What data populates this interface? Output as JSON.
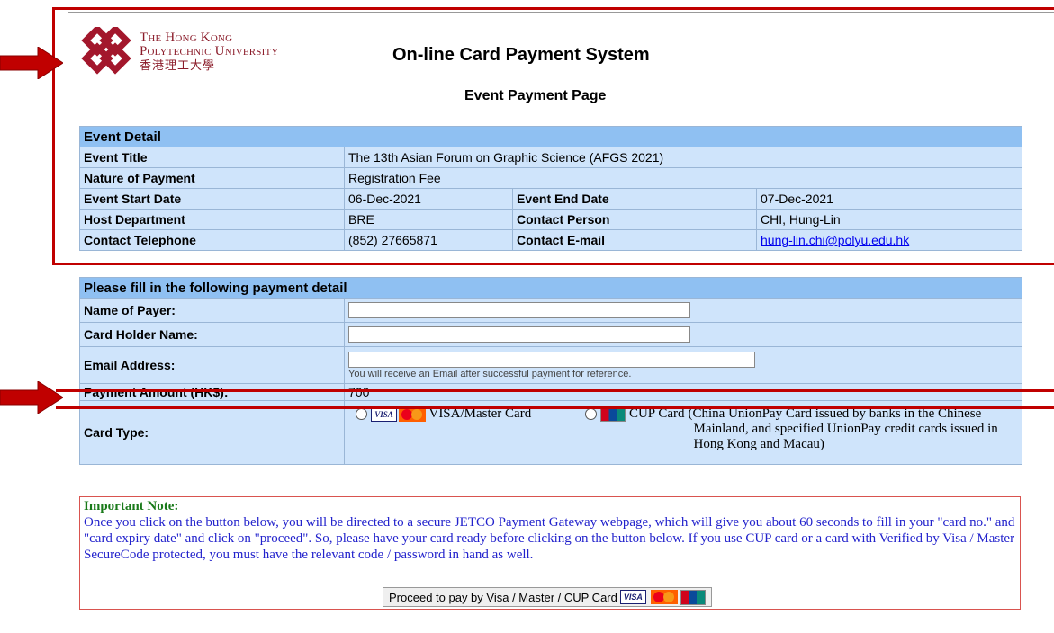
{
  "logo": {
    "line1": "The Hong Kong",
    "line2": "Polytechnic University",
    "line3": "香港理工大學"
  },
  "system_title": "On-line Card Payment System",
  "page_subtitle": "Event Payment Page",
  "event_detail": {
    "header": "Event Detail",
    "title_label": "Event Title",
    "title_value": "The 13th Asian Forum on Graphic Science (AFGS 2021)",
    "nature_label": "Nature of Payment",
    "nature_value": "Registration Fee",
    "start_label": "Event Start Date",
    "start_value": "06-Dec-2021",
    "end_label": "Event End Date",
    "end_value": "07-Dec-2021",
    "host_label": "Host Department",
    "host_value": "BRE",
    "contact_label": "Contact Person",
    "contact_value": "CHI, Hung-Lin",
    "tel_label": "Contact Telephone",
    "tel_value": "(852) 27665871",
    "email_label": "Contact E-mail",
    "email_value": "hung-lin.chi@polyu.edu.hk"
  },
  "payment_form": {
    "header": "Please fill in the following payment detail",
    "payer_label": "Name of Payer:",
    "payer_value": "",
    "holder_label": "Card Holder Name:",
    "holder_value": "",
    "email_label": "Email Address:",
    "email_value": "",
    "email_hint": "You will receive an Email after successful payment for reference.",
    "amount_label": "Payment Amount (HK$):",
    "amount_value": "700",
    "card_type_label": "Card Type:",
    "visa_logo": "VISA",
    "visa_option": "VISA/Master Card",
    "cup_option": "CUP Card",
    "cup_note": "(China UnionPay Card issued by banks in the Chinese Mainland, and specified UnionPay credit cards issued in Hong Kong and Macau)"
  },
  "note": {
    "title": "Important Note:",
    "body": "Once you click on the button below, you will be directed to a secure JETCO Payment Gateway webpage, which will give you about 60 seconds to fill in your \"card no.\" and \"card expiry date\" and click on \"proceed\". So, please have your card ready before clicking on the button below. If you use CUP card or a card with Verified by Visa / Master SecureCode protected, you must have the relevant code / password in hand as well.",
    "button_label": "Proceed to pay by Visa / Master / CUP Card"
  },
  "colors": {
    "header_bg": "#8fc0f2",
    "cell_bg": "#cfe4fb",
    "annotation_red": "#c00000",
    "note_title": "#1a7a1a",
    "note_body": "#2222cc"
  },
  "icons": [
    "polyu-logo-icon",
    "visa-icon",
    "mastercard-icon",
    "unionpay-icon",
    "radio-icon",
    "arrow-icon"
  ]
}
